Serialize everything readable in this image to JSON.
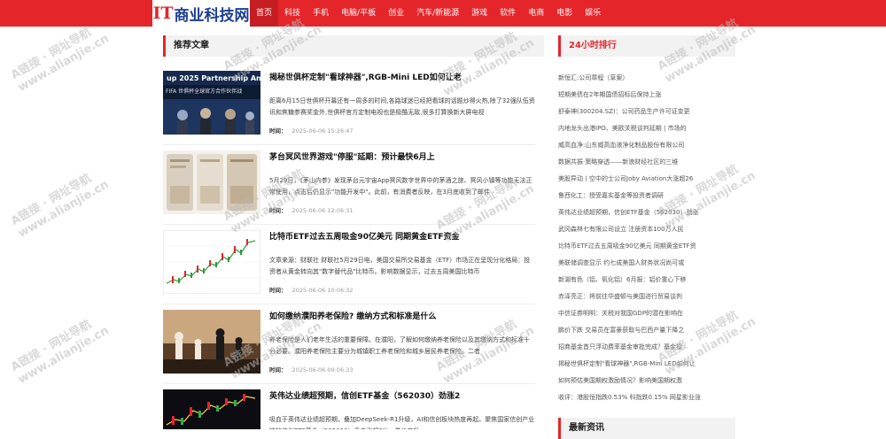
{
  "header": {
    "logo_prefix": "IT",
    "logo_text": "商业科技网",
    "nav": [
      {
        "label": "首页",
        "active": true
      },
      {
        "label": "科技"
      },
      {
        "label": "手机"
      },
      {
        "label": "电脑/平板"
      },
      {
        "label": "创业"
      },
      {
        "label": "汽车/新能源"
      },
      {
        "label": "游戏"
      },
      {
        "label": "软件"
      },
      {
        "label": "电商"
      },
      {
        "label": "电影"
      },
      {
        "label": "娱乐"
      }
    ]
  },
  "recommended": {
    "heading": "推荐文章",
    "meta_label": "时间：",
    "articles": [
      {
        "title": "揭秘世俱杯定制\"看球神器\",RGB-Mini LED如何让老",
        "summary": "距离6月15日世俱杯开幕还有一周多的时间,各路球迷已经把看球的话题炒得火热,除了32强队伍资讯和焦糖参赛奖金外,世俱杯官方定制电视也是极酷无敌,很多打算换新大屏电视",
        "time": "2025-06-06 15:26:47",
        "thumb_caption": "FIFA 世俱杯全球官方合作伙伴战",
        "thumb_top": "up 2025 Partnership An"
      },
      {
        "title": "茅台冥风世界游戏\"停服\"延期：预计最快6月上",
        "summary": "5月29日，《茅山内参》发现茅台元宇宙App冥风数字世界中的茅酒之旅、冥风小镇等功能无法正常使用，点击后仍显示\"功能开发中\"。此前，有消费者反映，在3月底收到了邮件",
        "time": "2025-06-06 12:06:31"
      },
      {
        "title": "比特币ETF过去五周吸金90亿美元 同期黄金ETF资金",
        "summary": "文章来源：财联社 财联社5月29日电，美国交易所交易基金（ETF）市场正在呈现分化格局：投资者从黄金转向其\"数字替代品\"比特币。影响数据显示，过去五周美国比特币",
        "time": "2025-06-06 10:06:32"
      },
      {
        "title": "如何缴纳濮阳养老保险? 缴纳方式和标准是什么",
        "summary": "养老保险是人们老年生活的重要保障。在濮阳，了解如何缴纳养老保险以及其缴纳方式和标准十分必要。濮阳养老保险主要分为城镇职工养老保险和城乡居民养老保险。二者",
        "time": "2025-06-06 09:06:33"
      },
      {
        "title": "英伟达业绩超预期，信创ETF基金（562030）劲涨2",
        "summary": "吸血于英伟达业绩超预期，叠加DeepSeek-R1升级，AI和信创板块热度再起。聚焦国家信创产业链的信创ETF基金（562030）盘中涨超2%，量价齐升",
        "time": ""
      }
    ]
  },
  "ranking": {
    "heading": "24小时排行",
    "items": [
      "新恒汇:公司章程（草案）",
      "短期美债在2年期国债招标后保持上涨",
      "舒泰神(300204.SZ)：公司药品生产许可证变更",
      "内地龙头出港IPO、美欧关税谈判延期 | 市场的",
      "威高血净:山东威高血液净化制品股份有限公司",
      "数据共振·策略穿透——新浪财经社区的三维",
      "美股异动丨空中的士公司Joby Aviation大涨超26",
      "鲁西化工：授受嘉实基金等投资者调研",
      "英伟达业绩超预期，信创ETF基金（562030）劲涨",
      "武冈森林七有限公司设立 注册资本100万人民",
      "比特币ETF过去五周吸金90亿美元 同期黄金ETF资",
      "美联储调查显示 约七成美国人财务状况尚可或",
      "新湖有色（铝、氧化铝）6月报：铝价重心下移",
      "赤泽亮正：将前往华盛顿与美国进行贸易谈判",
      "中信证券明明：关税对我国GDP的潜在影响在",
      "鹏价下跌 交易员在富豪获取与巴西产量下降之",
      "招商基金首只浮动费率基金审批完成？基金投",
      "揭秘世俱杯定制\"看球神器\",RGB-Mini LED如何让",
      "如何预估美国期权激励情况？影响美国期权激",
      "收评：港股恒指跌0.53% 科指跌0.15% 网星影业涨"
    ]
  },
  "latest": {
    "heading": "最新资讯"
  },
  "watermark": {
    "line1": "A链接 · 网址导航",
    "line2": "www.alianjie.cn"
  }
}
